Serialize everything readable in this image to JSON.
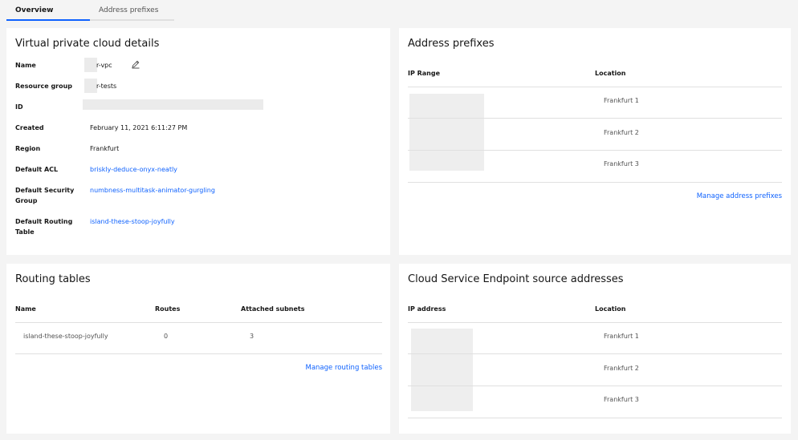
{
  "tabs": [
    {
      "label": "Overview",
      "active": true
    },
    {
      "label": "Address prefixes",
      "active": false
    }
  ],
  "vpc_details": {
    "title": "Virtual private cloud details",
    "rows": [
      {
        "label": "Name",
        "value": "r-vpc"
      },
      {
        "label": "Resource group",
        "value": "r-tests"
      },
      {
        "label": "ID",
        "value": ""
      },
      {
        "label": "Created",
        "value": "February 11, 2021 6:11:27 PM"
      },
      {
        "label": "Region",
        "value": "Frankfurt"
      },
      {
        "label": "Default ACL",
        "value": "briskly-deduce-onyx-neatly"
      },
      {
        "label": "Default Security Group",
        "value": "numbness-multitask-animator-gurgling"
      },
      {
        "label": "Default Routing Table",
        "value": "island-these-stoop-joyfully"
      }
    ]
  },
  "address_prefixes": {
    "title": "Address prefixes",
    "columns": [
      "IP Range",
      "Location"
    ],
    "rows": [
      {
        "location": "Frankfurt 1"
      },
      {
        "location": "Frankfurt 2"
      },
      {
        "location": "Frankfurt 3"
      }
    ],
    "manage_link": "Manage address prefixes"
  },
  "routing_tables": {
    "title": "Routing tables",
    "columns": [
      "Name",
      "Routes",
      "Attached subnets"
    ],
    "rows": [
      {
        "name": "island-these-stoop-joyfully",
        "routes": "0",
        "subnets": "3"
      }
    ],
    "manage_link": "Manage routing tables"
  },
  "cse": {
    "title": "Cloud Service Endpoint source addresses",
    "columns": [
      "IP address",
      "Location"
    ],
    "rows": [
      {
        "location": "Frankfurt 1"
      },
      {
        "location": "Frankfurt 2"
      },
      {
        "location": "Frankfurt 3"
      }
    ]
  },
  "colors": {
    "link": "#0f62fe",
    "tab_active": "#0f62fe",
    "background": "#f4f4f4"
  },
  "icons": {
    "edit": "edit-icon"
  }
}
